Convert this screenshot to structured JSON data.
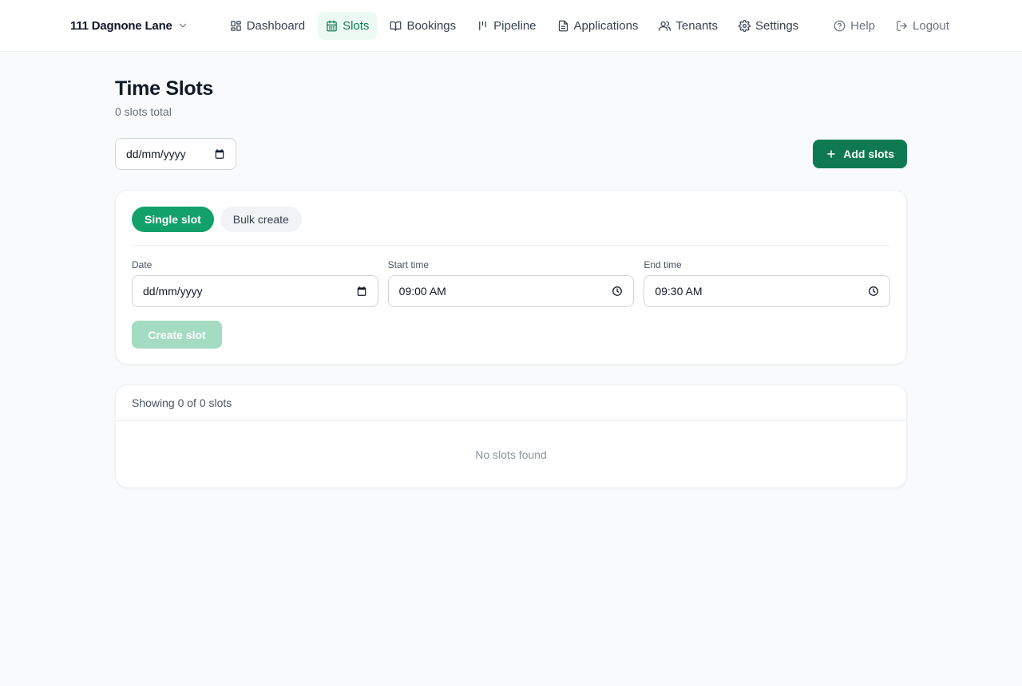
{
  "header": {
    "property_name": "111 Dagnone Lane",
    "nav": [
      {
        "label": "Dashboard",
        "icon": "dashboard-icon"
      },
      {
        "label": "Slots",
        "icon": "calendar-icon",
        "active": true
      },
      {
        "label": "Bookings",
        "icon": "book-icon"
      },
      {
        "label": "Pipeline",
        "icon": "pipeline-icon"
      },
      {
        "label": "Applications",
        "icon": "document-icon"
      },
      {
        "label": "Tenants",
        "icon": "users-icon"
      },
      {
        "label": "Settings",
        "icon": "gear-icon"
      }
    ],
    "help_label": "Help",
    "logout_label": "Logout"
  },
  "page": {
    "title": "Time Slots",
    "subtitle": "0 slots total"
  },
  "filter": {
    "date_placeholder": "dd/mm/yyyy",
    "add_label": "Add slots"
  },
  "create": {
    "tabs": [
      {
        "label": "Single slot",
        "active": true
      },
      {
        "label": "Bulk create",
        "active": false
      }
    ],
    "date_label": "Date",
    "date_value": "dd/mm/yyyy",
    "start_label": "Start time",
    "start_value": "09:00 AM",
    "end_label": "End time",
    "end_value": "09:30 AM",
    "submit_label": "Create slot"
  },
  "list": {
    "showing": "Showing 0 of 0 slots",
    "empty": "No slots found"
  },
  "colors": {
    "accent": "#0f7a52",
    "accent_light": "#12a06b",
    "active_nav_bg": "#ecfaf3"
  }
}
